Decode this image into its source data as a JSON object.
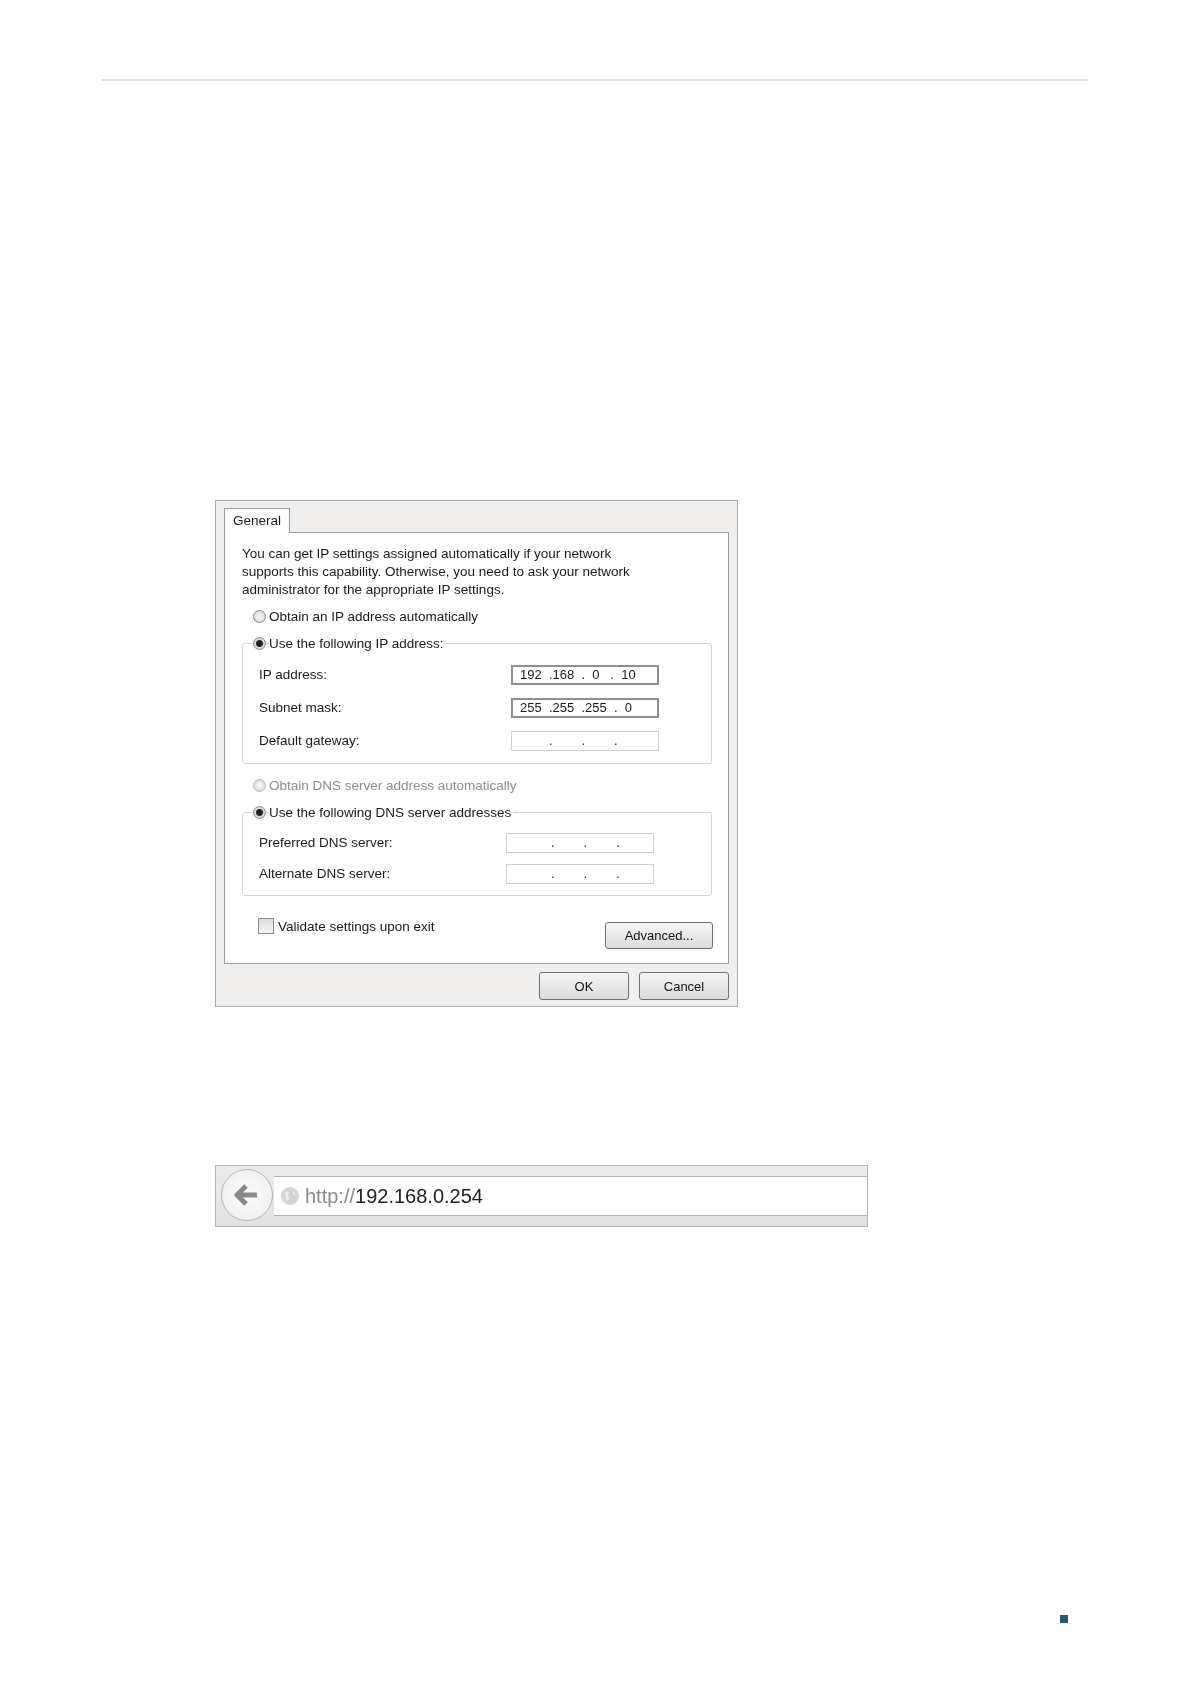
{
  "dialog": {
    "tabs": [
      {
        "label": "General",
        "selected": true
      }
    ],
    "description": "You can get IP settings assigned automatically if your network supports this capability. Otherwise, you need to ask your network administrator for the appropriate IP settings.",
    "sections": [
      {
        "options": [
          {
            "label": "Obtain an IP address automatically",
            "selected": false,
            "disabled": false
          },
          {
            "label": "Use the following IP address:",
            "selected": true,
            "disabled": false
          }
        ],
        "fields": [
          {
            "label": "IP address:",
            "value": "192  .168  .  0   .  10",
            "filled": true
          },
          {
            "label": "Subnet mask:",
            "value": "255  .255  .255  .  0",
            "filled": true
          },
          {
            "label": "Default gateway:",
            "value": "        .        .        .",
            "filled": false
          }
        ]
      },
      {
        "options": [
          {
            "label": "Obtain DNS server address automatically",
            "selected": false,
            "disabled": true
          },
          {
            "label": "Use the following DNS server addresses",
            "selected": true,
            "disabled": false
          }
        ],
        "fields": [
          {
            "label": "Preferred DNS server:",
            "value": "          .        .        .",
            "filled": false
          },
          {
            "label": "Alternate DNS server:",
            "value": "          .        .        .",
            "filled": false
          }
        ]
      }
    ],
    "validate": {
      "label": "Validate settings upon exit",
      "checked": false
    },
    "advanced_button": "Advanced...",
    "buttons": [
      "OK",
      "Cancel"
    ]
  },
  "browser": {
    "url_scheme": "http://",
    "url_host": "192.168.0.254"
  }
}
